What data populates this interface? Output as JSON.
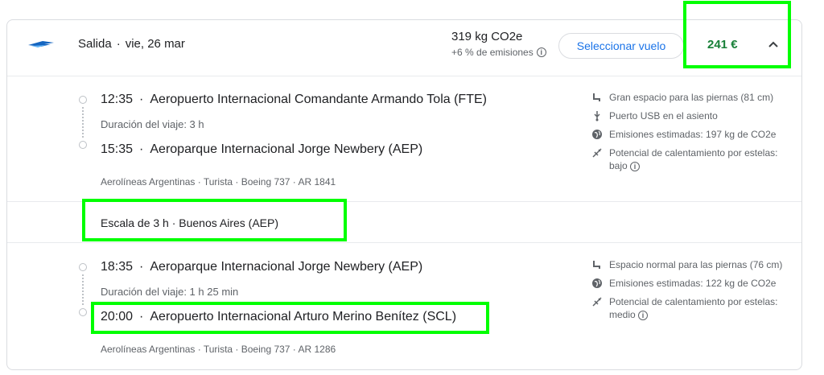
{
  "header": {
    "title": "Salida",
    "date": "vie, 26 mar",
    "co2_main": "319 kg CO2e",
    "co2_sub": "+6 % de emisiones",
    "select_label": "Seleccionar vuelo",
    "price": "241 €"
  },
  "segments": [
    {
      "dep_time": "12:35",
      "dep_airport": "Aeropuerto Internacional Comandante Armando Tola (FTE)",
      "duration": "Duración del viaje: 3 h",
      "arr_time": "15:35",
      "arr_airport": "Aeroparque Internacional Jorge Newbery (AEP)",
      "details": "Aerolíneas Argentinas · Turista · Boeing 737 · AR 1841",
      "amenities": [
        {
          "icon": "legroom-icon",
          "text": "Gran espacio para las piernas (81 cm)"
        },
        {
          "icon": "usb-icon",
          "text": "Puerto USB en el asiento"
        },
        {
          "icon": "globe-icon",
          "text": "Emisiones estimadas: 197 kg de CO2e"
        },
        {
          "icon": "contrail-icon",
          "text": "Potencial de calentamiento por estelas: bajo"
        }
      ]
    },
    {
      "dep_time": "18:35",
      "dep_airport": "Aeroparque Internacional Jorge Newbery (AEP)",
      "duration": "Duración del viaje: 1 h 25 min",
      "arr_time": "20:00",
      "arr_airport": "Aeropuerto Internacional Arturo Merino Benítez (SCL)",
      "details": "Aerolíneas Argentinas · Turista · Boeing 737 · AR 1286",
      "amenities": [
        {
          "icon": "legroom-icon",
          "text": "Espacio normal para las piernas (76 cm)"
        },
        {
          "icon": "globe-icon",
          "text": "Emisiones estimadas: 122 kg de CO2e"
        },
        {
          "icon": "contrail-icon",
          "text": "Potencial de calentamiento por estelas: medio"
        }
      ]
    }
  ],
  "layover": {
    "text": "Escala de 3 h · Buenos Aires (AEP)"
  },
  "colors": {
    "accent": "#1a73e8",
    "price": "#188038",
    "highlight": "#00ff00"
  }
}
